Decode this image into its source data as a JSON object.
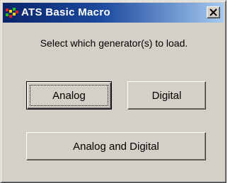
{
  "window": {
    "title": "ATS Basic Macro",
    "icon": "ats-app-icon",
    "close_icon": "close-x-icon"
  },
  "dialog": {
    "prompt": "Select which generator(s) to load."
  },
  "buttons": {
    "analog_label": "Analog",
    "digital_label": "Digital",
    "both_label": "Analog and Digital"
  },
  "colors": {
    "titlebar_start": "#0a246a",
    "titlebar_end": "#a6caf0",
    "face": "#d4d0c8"
  }
}
